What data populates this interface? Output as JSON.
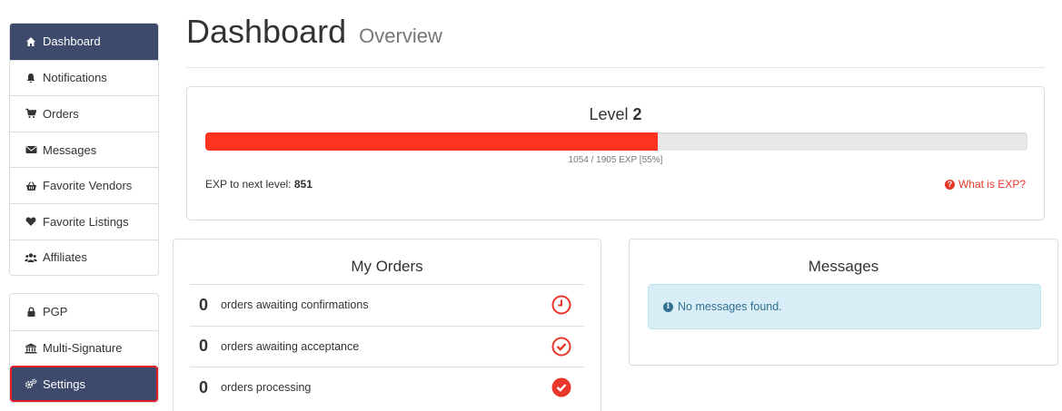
{
  "sidebar": {
    "primary": [
      {
        "label": "Dashboard",
        "icon": "home-icon"
      },
      {
        "label": "Notifications",
        "icon": "bell-icon"
      },
      {
        "label": "Orders",
        "icon": "cart-icon"
      },
      {
        "label": "Messages",
        "icon": "envelope-icon"
      },
      {
        "label": "Favorite Vendors",
        "icon": "basket-icon"
      },
      {
        "label": "Favorite Listings",
        "icon": "heart-icon"
      },
      {
        "label": "Affiliates",
        "icon": "users-icon"
      }
    ],
    "secondary": [
      {
        "label": "PGP",
        "icon": "lock-icon"
      },
      {
        "label": "Multi-Signature",
        "icon": "bank-icon"
      },
      {
        "label": "Settings",
        "icon": "gears-icon"
      }
    ],
    "active": "Dashboard",
    "highlighted": "Settings"
  },
  "header": {
    "title": "Dashboard",
    "subtitle": "Overview"
  },
  "level": {
    "title_prefix": "Level",
    "level_number": "2",
    "progress_fraction": 0.55,
    "progress_text": "1054 / 1905 EXP [55%]",
    "exp_next_label": "EXP to next level:",
    "exp_next_value": "851",
    "help_link": "What is EXP?"
  },
  "orders": {
    "title": "My Orders",
    "rows": [
      {
        "count": "0",
        "label": "orders awaiting confirmations",
        "icon": "clock-icon"
      },
      {
        "count": "0",
        "label": "orders awaiting acceptance",
        "icon": "check-circle-outline-icon"
      },
      {
        "count": "0",
        "label": "orders processing",
        "icon": "check-circle-filled-icon"
      }
    ]
  },
  "messages": {
    "title": "Messages",
    "empty_text": "No messages found."
  },
  "colors": {
    "nav_active": "#3d4a6b",
    "accent_red": "#ff3322",
    "link_red": "#e8362a",
    "info_bg": "#d9edf7",
    "info_text": "#31708f"
  }
}
